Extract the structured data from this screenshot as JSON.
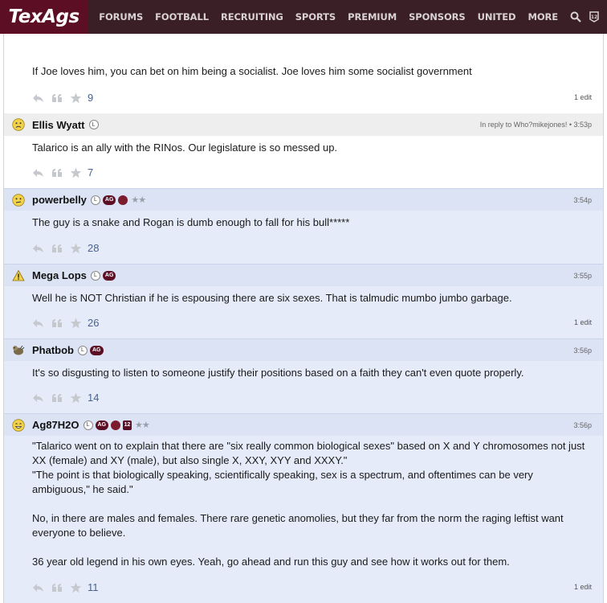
{
  "nav": {
    "logo": "TexAgs",
    "items": [
      "FORUMS",
      "FOOTBALL",
      "RECRUITING",
      "SPORTS",
      "PREMIUM",
      "SPONSORS",
      "UNITED",
      "MORE"
    ]
  },
  "posts": [
    {
      "text": "If Joe loves him, you can bet on him being a socialist. Joe loves him some socialist government",
      "likes": "9",
      "edit": "1 edit"
    },
    {
      "username": "Ellis Wyatt",
      "meta": "In reply to Who?mikejones! • 3:53p",
      "text": "Talarico is an ally with the RINos. Our legislature is so messed up.",
      "likes": "7"
    },
    {
      "username": "powerbelly",
      "meta": "3:54p",
      "text": "The guy is a snake and Rogan is dumb enough to fall for his bull*****",
      "likes": "28"
    },
    {
      "username": "Mega Lops",
      "meta": "3:55p",
      "text": "Well he is NOT Christian if he is espousing there are six sexes. That is talmudic mumbo jumbo garbage.",
      "likes": "26",
      "edit": "1 edit"
    },
    {
      "username": "Phatbob",
      "meta": "3:56p",
      "text": "It's so disgusting to listen to someone justify their positions based on a faith they can't even quote properly.",
      "likes": "14"
    },
    {
      "username": "Ag87H2O",
      "meta": "3:56p",
      "text": "\"Talarico went on to explain that there are \"six really common biological sexes\" based on X and Y chromosomes not just XX (female) and XY (male), but also single X, XXY, XYY and XXXY.\"\n\"The point is that biologically speaking, scientifically speaking, sex is a spectrum, and oftentimes can be very ambiguous,\" he said.\"\n\nNo, in there are males and females. There rare genetic anomolies, but they far from the norm the raging leftist want everyone to believe.\n\n36 year old legend in his own eyes. Yeah, go ahead and run this guy and see how it works out for them.",
      "likes": "11",
      "edit": "1 edit"
    }
  ],
  "badges": {
    "l": "L",
    "ag": "AG",
    "twelve": "12"
  },
  "colors": {
    "nav_bg": "#3b1f27",
    "logo_bg": "#5c0f24",
    "post_blue": "#e5ebf8",
    "header_blue": "#dbe3f4",
    "count_blue": "#49628f"
  },
  "icons": [
    "search-icon",
    "twelfth-man-icon",
    "reply-icon",
    "quote-icon",
    "star-icon"
  ]
}
